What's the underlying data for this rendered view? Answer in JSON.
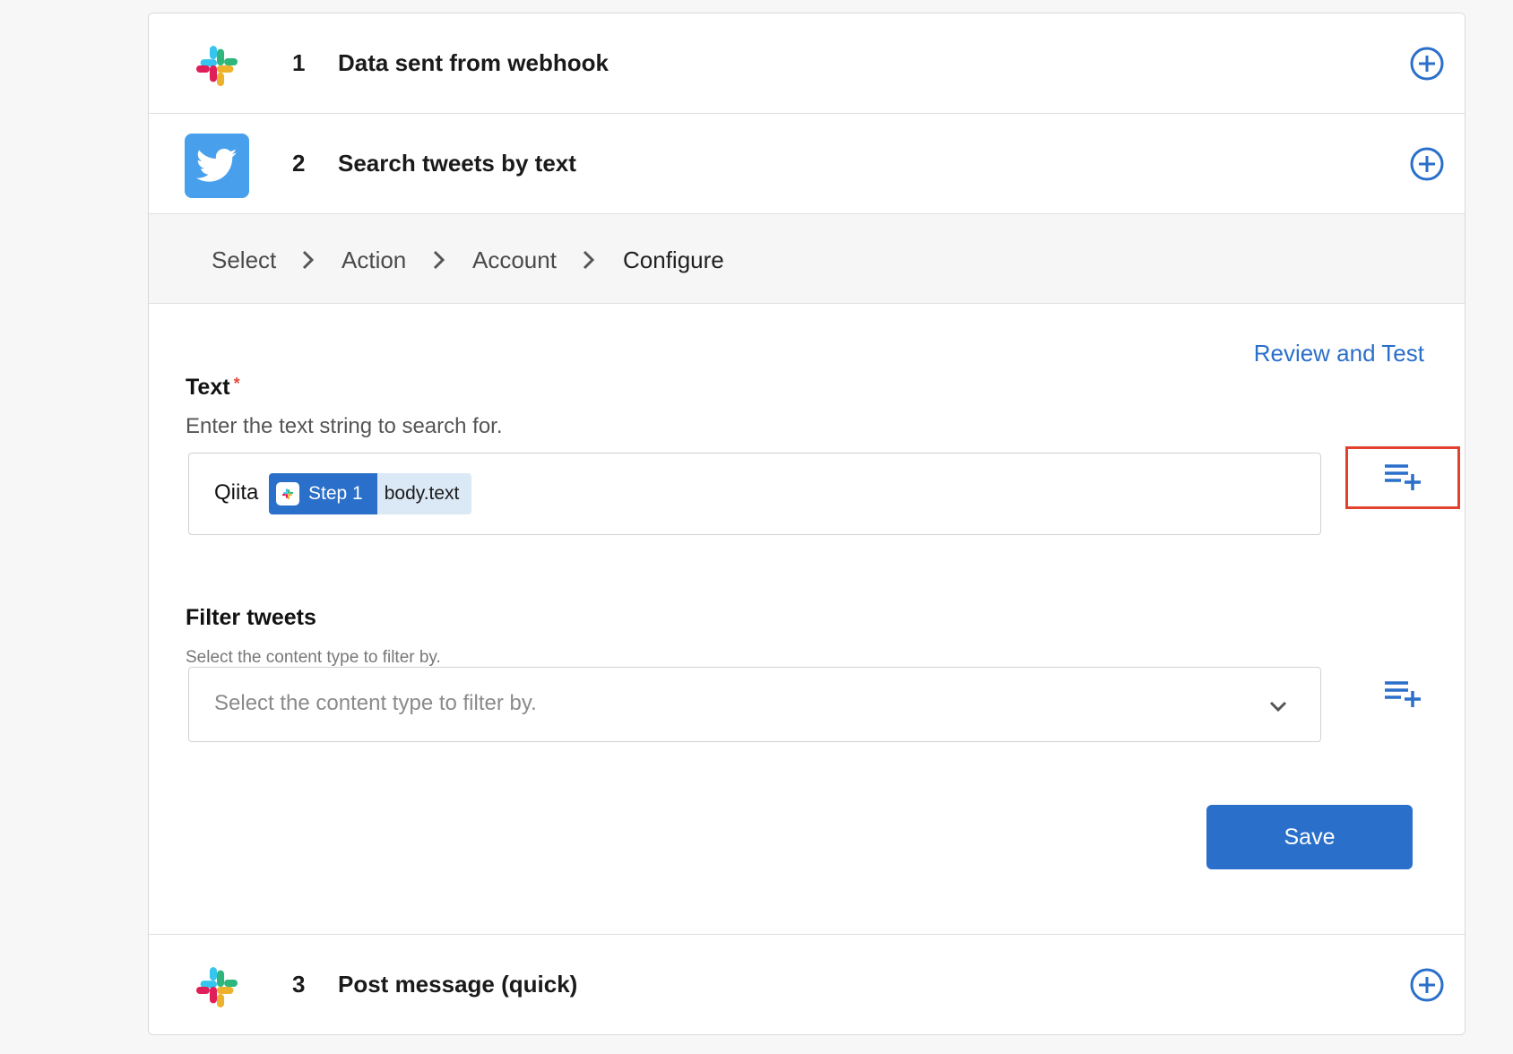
{
  "steps": [
    {
      "number": "1",
      "title": "Data sent from webhook",
      "app_icon": "slack-icon"
    },
    {
      "number": "2",
      "title": "Search tweets by text",
      "app_icon": "twitter-icon"
    },
    {
      "number": "3",
      "title": "Post message (quick)",
      "app_icon": "slack-icon"
    }
  ],
  "breadcrumb": [
    "Select",
    "Action",
    "Account",
    "Configure"
  ],
  "review_link": "Review and Test",
  "text_field": {
    "label": "Text",
    "required_mark": "*",
    "help": "Enter the text string to search for.",
    "static_text": "Qiita",
    "pill_step": "Step 1",
    "pill_field": "body.text"
  },
  "filter_field": {
    "label": "Filter tweets",
    "help": "Select the content type to filter by.",
    "placeholder": "Select the content type to filter by."
  },
  "save_label": "Save",
  "colors": {
    "accent": "#2a6fc9",
    "highlight": "#e2412e",
    "twitter": "#48a0ec",
    "pill_field_bg": "#dbe8f6"
  }
}
